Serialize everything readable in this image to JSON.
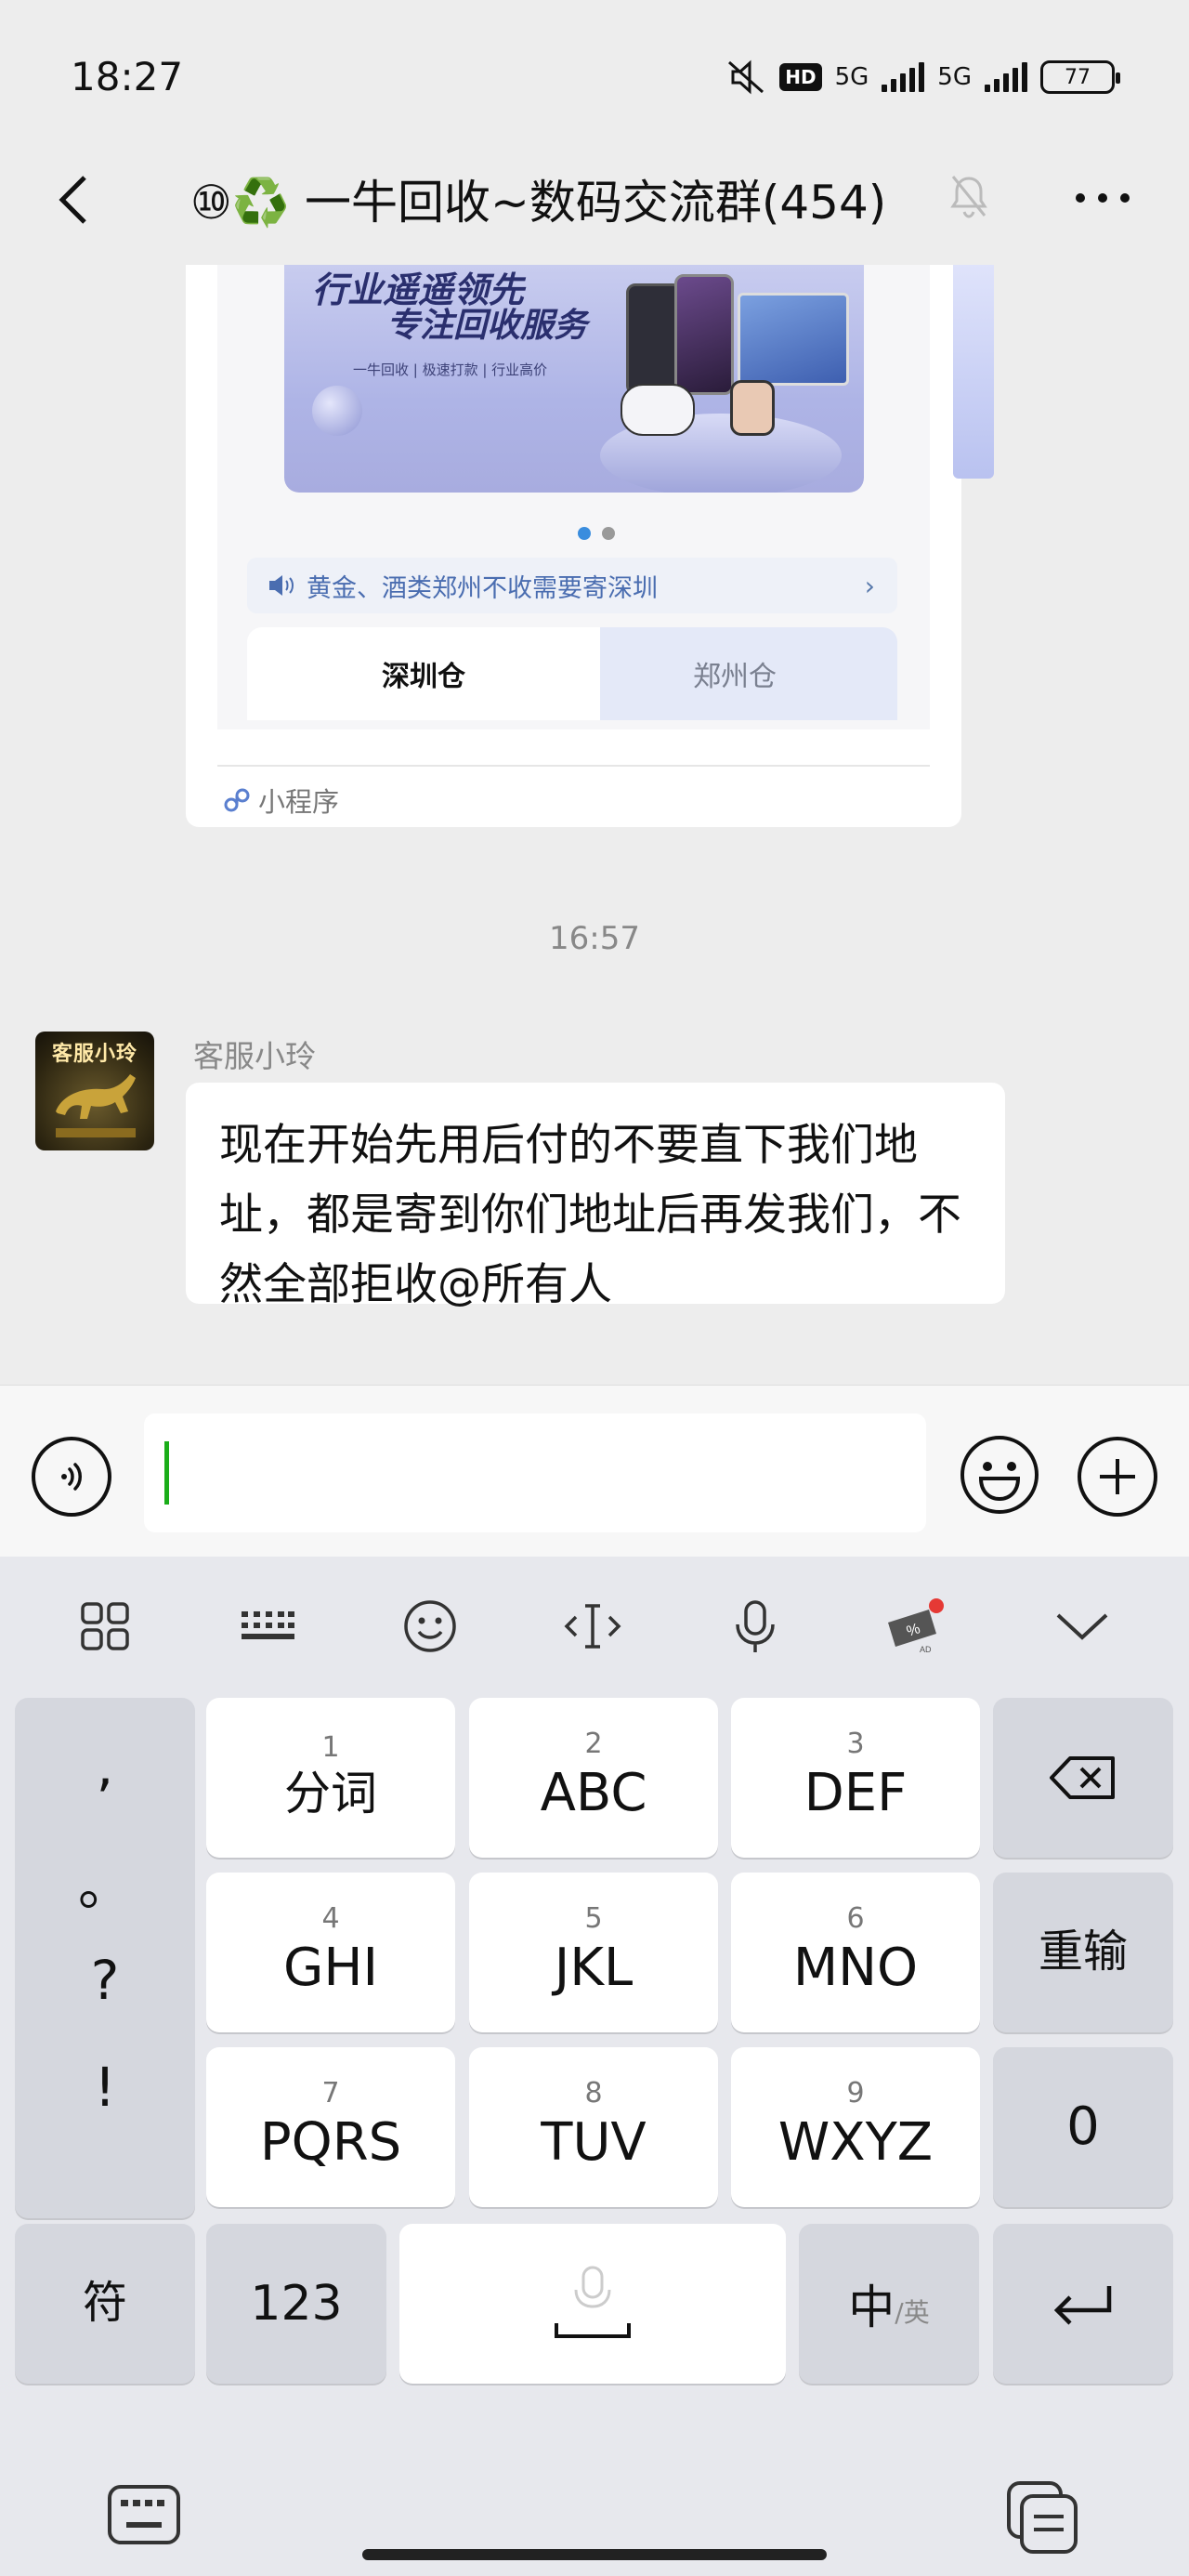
{
  "status_bar": {
    "time": "18:27",
    "hd": "HD",
    "net1": "5G",
    "net2": "5G",
    "battery": "77"
  },
  "header": {
    "back_label": "<",
    "title": "⑩♻️ 一牛回收~数码交流群(454)"
  },
  "mini_program": {
    "banner_line1": "行业遥遥领先",
    "banner_line2": "专注回收服务",
    "banner_sub": "一牛回收 | 极速打款 | 行业高价",
    "notice": "黄金、酒类郑州不收需要寄深圳",
    "notice_arrow": "›",
    "tab_active": "深圳仓",
    "tab_inactive": "郑州仓",
    "label": "小程序"
  },
  "timestamp": "16:57",
  "message": {
    "avatar_text": "客服小玲",
    "sender": "客服小玲",
    "text": "现在开始先用后付的不要直下我们地址，都是寄到你们地址后再发我们，不然全部拒收@所有人"
  },
  "keyboard": {
    "keys": [
      {
        "num": "1",
        "label": "分词"
      },
      {
        "num": "2",
        "label": "ABC"
      },
      {
        "num": "3",
        "label": "DEF"
      },
      {
        "num": "4",
        "label": "GHI"
      },
      {
        "num": "5",
        "label": "JKL"
      },
      {
        "num": "6",
        "label": "MNO"
      },
      {
        "num": "7",
        "label": "PQRS"
      },
      {
        "num": "8",
        "label": "TUV"
      },
      {
        "num": "9",
        "label": "WXYZ"
      }
    ],
    "punct": [
      ",",
      "。",
      "?",
      "!"
    ],
    "reinput": "重输",
    "zero": "0",
    "symbols": "符",
    "numbers": "123",
    "lang_main": "中",
    "lang_sub": "/英",
    "accent": "#e53935"
  }
}
